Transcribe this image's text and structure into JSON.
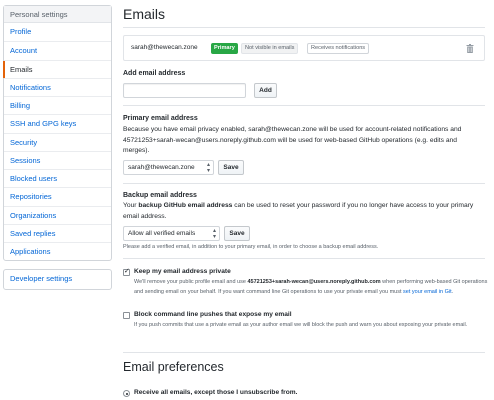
{
  "sidebar": {
    "heading": "Personal settings",
    "items": [
      {
        "label": "Profile",
        "active": false
      },
      {
        "label": "Account",
        "active": false
      },
      {
        "label": "Emails",
        "active": true
      },
      {
        "label": "Notifications",
        "active": false
      },
      {
        "label": "Billing",
        "active": false
      },
      {
        "label": "SSH and GPG keys",
        "active": false
      },
      {
        "label": "Security",
        "active": false
      },
      {
        "label": "Sessions",
        "active": false
      },
      {
        "label": "Blocked users",
        "active": false
      },
      {
        "label": "Repositories",
        "active": false
      },
      {
        "label": "Organizations",
        "active": false
      },
      {
        "label": "Saved replies",
        "active": false
      },
      {
        "label": "Applications",
        "active": false
      }
    ],
    "developer_settings": "Developer settings"
  },
  "main": {
    "title": "Emails",
    "email": {
      "address": "sarah@thewecan.zone",
      "badges": {
        "primary": "Primary",
        "not_visible": "Not visible in emails",
        "receives": "Receives notifications"
      },
      "delete_icon": "trash-icon"
    },
    "add_email": {
      "label": "Add email address",
      "value": "",
      "button": "Add"
    },
    "primary": {
      "label": "Primary email address",
      "description": "Because you have email privacy enabled, sarah@thewecan.zone will be used for account-related notifications and 45721253+sarah-wecan@users.noreply.github.com will be used for web-based GitHub operations (e.g. edits and merges).",
      "select_value": "sarah@thewecan.zone",
      "button": "Save"
    },
    "backup": {
      "label": "Backup email address",
      "description_prefix": "Your ",
      "description_bold": "backup GitHub email address",
      "description_suffix": " can be used to reset your password if you no longer have access to your primary email address.",
      "select_value": "Allow all verified emails",
      "button": "Save",
      "note": "Please add a verified email, in addition to your primary email, in order to choose a backup email address."
    },
    "keep_private": {
      "checked": true,
      "label": "Keep my email address private",
      "note_1": "We'll remove your public profile email and use ",
      "note_email": "45721253+sarah-wecan@users.noreply.github.com",
      "note_2": " when performing web-based Git operations and sending email on your behalf. If you want command line Git operations to use your private email you must ",
      "note_link": "set your email in Git",
      "note_3": "."
    },
    "block_push": {
      "checked": false,
      "label": "Block command line pushes that expose my email",
      "note": "If you push commits that use a private email as your author email we will block the push and warn you about exposing your private email."
    },
    "preferences": {
      "title": "Email preferences",
      "option_1": "Receive all emails, except those I unsubscribe from."
    }
  },
  "colors": {
    "link": "#0366d6",
    "primary_badge": "#28a745",
    "active_marker": "#e36209"
  }
}
